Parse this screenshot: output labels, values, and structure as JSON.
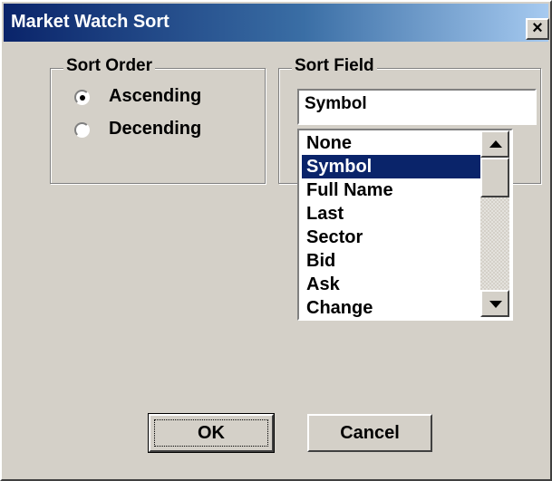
{
  "window": {
    "title": "Market Watch Sort",
    "close_label": "×"
  },
  "sort_order": {
    "legend": "Sort Order",
    "options": [
      {
        "label": "Ascending",
        "selected": true
      },
      {
        "label": "Decending",
        "selected": false
      }
    ]
  },
  "sort_field": {
    "legend": "Sort Field",
    "value": "Symbol",
    "items": [
      {
        "label": "None",
        "selected": false
      },
      {
        "label": "Symbol",
        "selected": true
      },
      {
        "label": "Full Name",
        "selected": false
      },
      {
        "label": "Last",
        "selected": false
      },
      {
        "label": "Sector",
        "selected": false
      },
      {
        "label": "Bid",
        "selected": false
      },
      {
        "label": "Ask",
        "selected": false
      },
      {
        "label": "Change",
        "selected": false
      }
    ],
    "scroll_up_icon": "arrow-up",
    "scroll_down_icon": "arrow-down"
  },
  "buttons": {
    "ok_label": "OK",
    "cancel_label": "Cancel"
  },
  "colors": {
    "face": "#d4d0c8",
    "title_start": "#0a246a",
    "title_end": "#a6caf0",
    "selection": "#0a246a"
  }
}
